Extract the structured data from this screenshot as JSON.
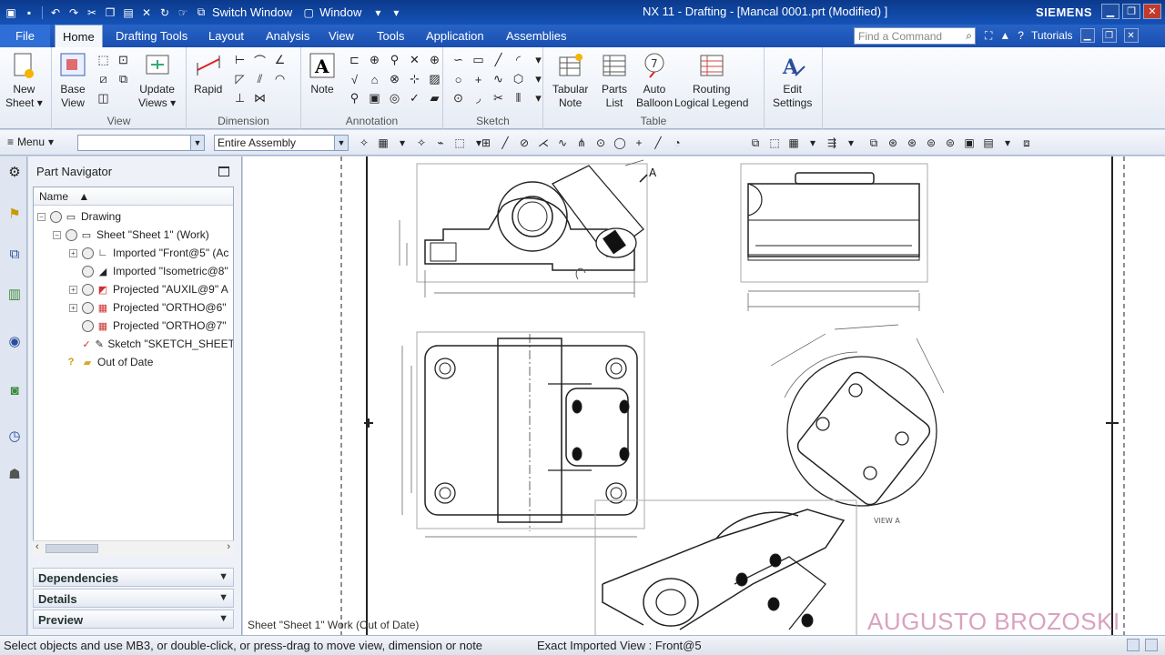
{
  "titlebar": {
    "switch_window": "Switch Window",
    "window": "Window",
    "title": "NX 11 - Drafting - [Mancal 0001.prt (Modified) ]",
    "brand": "SIEMENS"
  },
  "menutabs": {
    "file": "File",
    "tabs": [
      "Home",
      "Drafting Tools",
      "Layout",
      "Analysis",
      "View",
      "Tools",
      "Application",
      "Assemblies"
    ],
    "find_placeholder": "Find a Command",
    "tutorials": "Tutorials"
  },
  "ribbon": {
    "new_sheet": [
      "New",
      "Sheet ▾"
    ],
    "base_view": [
      "Base",
      "View"
    ],
    "update_views": [
      "Update",
      "Views ▾"
    ],
    "view_group": "View",
    "rapid": "Rapid",
    "dimension_group": "Dimension",
    "note": "Note",
    "annotation_group": "Annotation",
    "sketch_group": "Sketch",
    "tabular_note": [
      "Tabular",
      "Note"
    ],
    "parts_list": [
      "Parts",
      "List"
    ],
    "auto_balloon": [
      "Auto",
      "Balloon"
    ],
    "routing_legend": [
      "Routing",
      "Logical Legend"
    ],
    "table_group": "Table",
    "edit_settings": [
      "Edit",
      "Settings"
    ]
  },
  "toolbar2": {
    "menu": "Menu",
    "filter_value": "",
    "scope": "Entire Assembly"
  },
  "navigator": {
    "title": "Part Navigator",
    "column": "Name",
    "items": [
      {
        "label": "Drawing"
      },
      {
        "label": "Sheet \"Sheet 1\" (Work)"
      },
      {
        "label": "Imported \"Front@5\" (Ac"
      },
      {
        "label": "Imported \"Isometric@8\""
      },
      {
        "label": "Projected \"AUXIL@9\" A"
      },
      {
        "label": "Projected \"ORTHO@6\""
      },
      {
        "label": "Projected \"ORTHO@7\""
      },
      {
        "label": "Sketch \"SKETCH_SHEET"
      },
      {
        "label": "Out of Date"
      }
    ],
    "panels": [
      "Dependencies",
      "Details",
      "Preview"
    ]
  },
  "drawing": {
    "sheet_status": "Sheet \"Sheet 1\" Work (Out of Date)",
    "view_a_label": "A",
    "view_a_caption": "VIEW A",
    "watermark": "AUGUSTO BROZOSKI"
  },
  "status": {
    "prompt": "Select objects and use MB3, or double-click, or press-drag to move view, dimension or note",
    "info": "Exact Imported View : Front@5"
  },
  "colors": {
    "title_bar": "#0b3a8c",
    "tab_bar": "#2763c5",
    "ribbon_bg": "#eef2f8",
    "watermark": "#d9a2c0"
  }
}
